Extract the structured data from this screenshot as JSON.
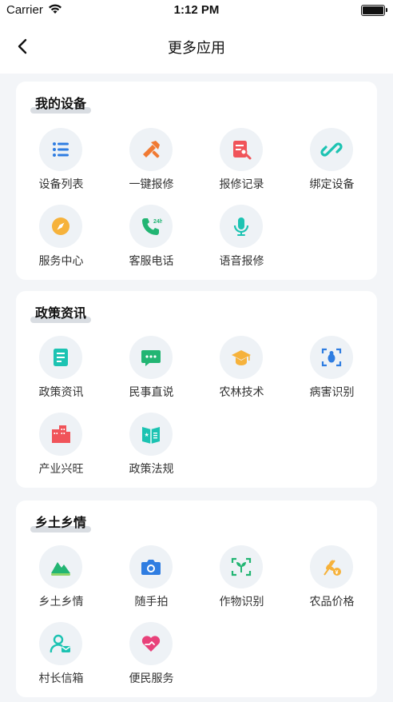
{
  "status": {
    "carrier": "Carrier",
    "time": "1:12 PM"
  },
  "nav": {
    "title": "更多应用"
  },
  "sections": [
    {
      "title": "我的设备",
      "items": [
        {
          "label": "设备列表",
          "icon": "list-icon"
        },
        {
          "label": "一键报修",
          "icon": "tools-icon"
        },
        {
          "label": "报修记录",
          "icon": "repair-record-icon"
        },
        {
          "label": "绑定设备",
          "icon": "link-icon"
        },
        {
          "label": "服务中心",
          "icon": "compass-icon"
        },
        {
          "label": "客服电话",
          "icon": "phone-24h-icon"
        },
        {
          "label": "语音报修",
          "icon": "microphone-icon"
        }
      ]
    },
    {
      "title": "政策资讯",
      "items": [
        {
          "label": "政策资讯",
          "icon": "document-icon"
        },
        {
          "label": "民事直说",
          "icon": "chat-icon"
        },
        {
          "label": "农林技术",
          "icon": "graduation-cap-icon"
        },
        {
          "label": "病害识别",
          "icon": "bug-scan-icon"
        },
        {
          "label": "产业兴旺",
          "icon": "buildings-icon"
        },
        {
          "label": "政策法规",
          "icon": "book-icon"
        }
      ]
    },
    {
      "title": "乡土乡情",
      "items": [
        {
          "label": "乡土乡情",
          "icon": "mountain-icon"
        },
        {
          "label": "随手拍",
          "icon": "camera-icon"
        },
        {
          "label": "作物识别",
          "icon": "plant-scan-icon"
        },
        {
          "label": "农品价格",
          "icon": "wheat-price-icon"
        },
        {
          "label": "村长信箱",
          "icon": "user-mail-icon"
        },
        {
          "label": "便民服务",
          "icon": "heart-hands-icon"
        }
      ]
    }
  ]
}
